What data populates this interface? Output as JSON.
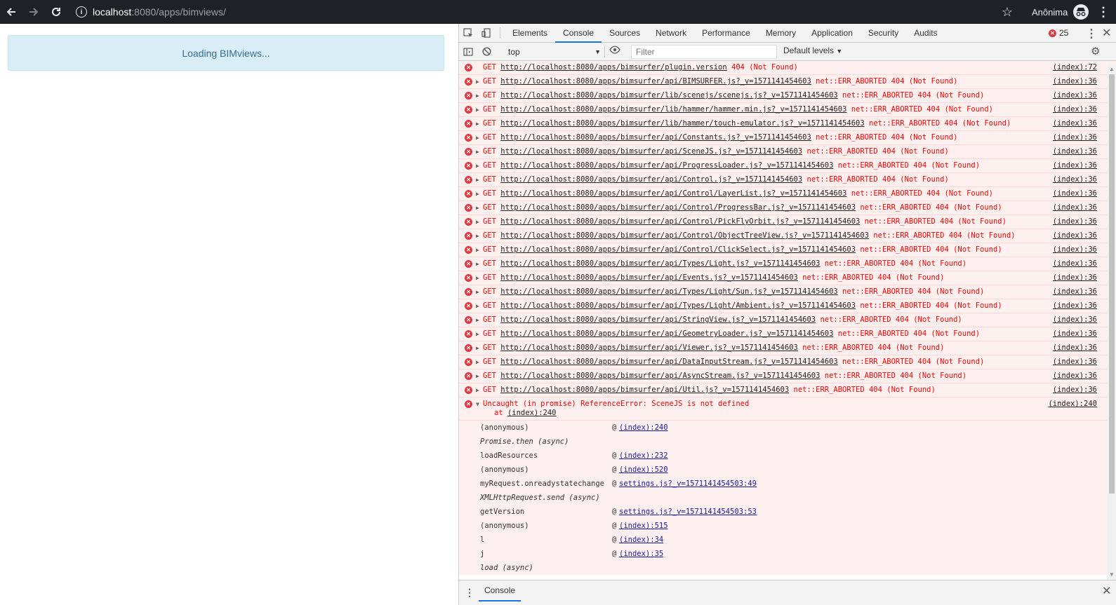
{
  "browser": {
    "url_host": "localhost",
    "url_path": ":8080/apps/bimviews/",
    "profile_name": "Anônima"
  },
  "page": {
    "loading_text": "Loading BIMviews..."
  },
  "devtools": {
    "tabs": [
      "Elements",
      "Console",
      "Sources",
      "Network",
      "Performance",
      "Memory",
      "Application",
      "Security",
      "Audits"
    ],
    "active_tab": "Console",
    "error_count": "25",
    "context": "top",
    "filter_placeholder": "Filter",
    "levels": "Default levels",
    "drawer_tab": "Console"
  },
  "console": {
    "errors": [
      {
        "method": "GET",
        "url": "http://localhost:8080/apps/bimsurfer/plugin.version",
        "msg": " 404 (Not Found)",
        "src": "(index):72",
        "expand": false
      },
      {
        "method": "GET",
        "url": "http://localhost:8080/apps/bimsurfer/api/BIMSURFER.js?_v=1571141454603",
        "msg": " net::ERR_ABORTED 404 (Not Found)",
        "src": "(index):36",
        "expand": true
      },
      {
        "method": "GET",
        "url": "http://localhost:8080/apps/bimsurfer/lib/scenejs/scenejs.js?_v=1571141454603",
        "msg": " net::ERR_ABORTED 404 (Not Found)",
        "src": "(index):36",
        "expand": true
      },
      {
        "method": "GET",
        "url": "http://localhost:8080/apps/bimsurfer/lib/hammer/hammer.min.js?_v=1571141454603",
        "msg": " net::ERR_ABORTED 404 (Not Found)",
        "src": "(index):36",
        "expand": true
      },
      {
        "method": "GET",
        "url": "http://localhost:8080/apps/bimsurfer/lib/hammer/touch-emulator.js?_v=1571141454603",
        "msg": " net::ERR_ABORTED 404 (Not Found)",
        "src": "(index):36",
        "expand": true
      },
      {
        "method": "GET",
        "url": "http://localhost:8080/apps/bimsurfer/api/Constants.js?_v=1571141454603",
        "msg": " net::ERR_ABORTED 404 (Not Found)",
        "src": "(index):36",
        "expand": true
      },
      {
        "method": "GET",
        "url": "http://localhost:8080/apps/bimsurfer/api/SceneJS.js?_v=1571141454603",
        "msg": " net::ERR_ABORTED 404 (Not Found)",
        "src": "(index):36",
        "expand": true
      },
      {
        "method": "GET",
        "url": "http://localhost:8080/apps/bimsurfer/api/ProgressLoader.js?_v=1571141454603",
        "msg": " net::ERR_ABORTED 404 (Not Found)",
        "src": "(index):36",
        "expand": true
      },
      {
        "method": "GET",
        "url": "http://localhost:8080/apps/bimsurfer/api/Control.js?_v=1571141454603",
        "msg": " net::ERR_ABORTED 404 (Not Found)",
        "src": "(index):36",
        "expand": true
      },
      {
        "method": "GET",
        "url": "http://localhost:8080/apps/bimsurfer/api/Control/LayerList.js?_v=1571141454603",
        "msg": " net::ERR_ABORTED 404 (Not Found)",
        "src": "(index):36",
        "expand": true
      },
      {
        "method": "GET",
        "url": "http://localhost:8080/apps/bimsurfer/api/Control/ProgressBar.js?_v=1571141454603",
        "msg": " net::ERR_ABORTED 404 (Not Found)",
        "src": "(index):36",
        "expand": true
      },
      {
        "method": "GET",
        "url": "http://localhost:8080/apps/bimsurfer/api/Control/PickFlyOrbit.js?_v=1571141454603",
        "msg": " net::ERR_ABORTED 404 (Not Found)",
        "src": "(index):36",
        "expand": true
      },
      {
        "method": "GET",
        "url": "http://localhost:8080/apps/bimsurfer/api/Control/ObjectTreeView.js?_v=1571141454603",
        "msg": " net::ERR_ABORTED 404 (Not Found)",
        "src": "(index):36",
        "expand": true
      },
      {
        "method": "GET",
        "url": "http://localhost:8080/apps/bimsurfer/api/Control/ClickSelect.js?_v=1571141454603",
        "msg": " net::ERR_ABORTED 404 (Not Found)",
        "src": "(index):36",
        "expand": true
      },
      {
        "method": "GET",
        "url": "http://localhost:8080/apps/bimsurfer/api/Types/Light.js?_v=1571141454603",
        "msg": " net::ERR_ABORTED 404 (Not Found)",
        "src": "(index):36",
        "expand": true
      },
      {
        "method": "GET",
        "url": "http://localhost:8080/apps/bimsurfer/api/Events.js?_v=1571141454603",
        "msg": " net::ERR_ABORTED 404 (Not Found)",
        "src": "(index):36",
        "expand": true
      },
      {
        "method": "GET",
        "url": "http://localhost:8080/apps/bimsurfer/api/Types/Light/Sun.js?_v=1571141454603",
        "msg": " net::ERR_ABORTED 404 (Not Found)",
        "src": "(index):36",
        "expand": true
      },
      {
        "method": "GET",
        "url": "http://localhost:8080/apps/bimsurfer/api/Types/Light/Ambient.js?_v=1571141454603",
        "msg": " net::ERR_ABORTED 404 (Not Found)",
        "src": "(index):36",
        "expand": true
      },
      {
        "method": "GET",
        "url": "http://localhost:8080/apps/bimsurfer/api/StringView.js?_v=1571141454603",
        "msg": " net::ERR_ABORTED 404 (Not Found)",
        "src": "(index):36",
        "expand": true
      },
      {
        "method": "GET",
        "url": "http://localhost:8080/apps/bimsurfer/api/GeometryLoader.js?_v=1571141454603",
        "msg": " net::ERR_ABORTED 404 (Not Found)",
        "src": "(index):36",
        "expand": true
      },
      {
        "method": "GET",
        "url": "http://localhost:8080/apps/bimsurfer/api/Viewer.js?_v=1571141454603",
        "msg": " net::ERR_ABORTED 404 (Not Found)",
        "src": "(index):36",
        "expand": true
      },
      {
        "method": "GET",
        "url": "http://localhost:8080/apps/bimsurfer/api/DataInputStream.js?_v=1571141454603",
        "msg": " net::ERR_ABORTED 404 (Not Found)",
        "src": "(index):36",
        "expand": true
      },
      {
        "method": "GET",
        "url": "http://localhost:8080/apps/bimsurfer/api/AsyncStream.js?_v=1571141454603",
        "msg": " net::ERR_ABORTED 404 (Not Found)",
        "src": "(index):36",
        "expand": true
      },
      {
        "method": "GET",
        "url": "http://localhost:8080/apps/bimsurfer/api/Util.js?_v=1571141454603",
        "msg": " net::ERR_ABORTED 404 (Not Found)",
        "src": "(index):36",
        "expand": true
      }
    ],
    "exception": {
      "text": "Uncaught (in promise) ReferenceError: SceneJS is not defined",
      "at_prefix": "at ",
      "at_link": "(index):240",
      "src": "(index):240"
    },
    "stack": [
      {
        "fn": "(anonymous)",
        "link": "(index):240",
        "async": false
      },
      {
        "fn": "Promise.then (async)",
        "link": "",
        "async": true
      },
      {
        "fn": "loadResources",
        "link": "(index):232",
        "async": false
      },
      {
        "fn": "(anonymous)",
        "link": "(index):520",
        "async": false
      },
      {
        "fn": "myRequest.onreadystatechange",
        "link": "settings.js?_v=1571141454503:49",
        "async": false
      },
      {
        "fn": "XMLHttpRequest.send (async)",
        "link": "",
        "async": true
      },
      {
        "fn": "getVersion",
        "link": "settings.js?_v=1571141454503:53",
        "async": false
      },
      {
        "fn": "(anonymous)",
        "link": "(index):515",
        "async": false
      },
      {
        "fn": "l",
        "link": "(index):34",
        "async": false
      },
      {
        "fn": "j",
        "link": "(index):35",
        "async": false
      },
      {
        "fn": "load (async)",
        "link": "",
        "async": true
      }
    ]
  }
}
